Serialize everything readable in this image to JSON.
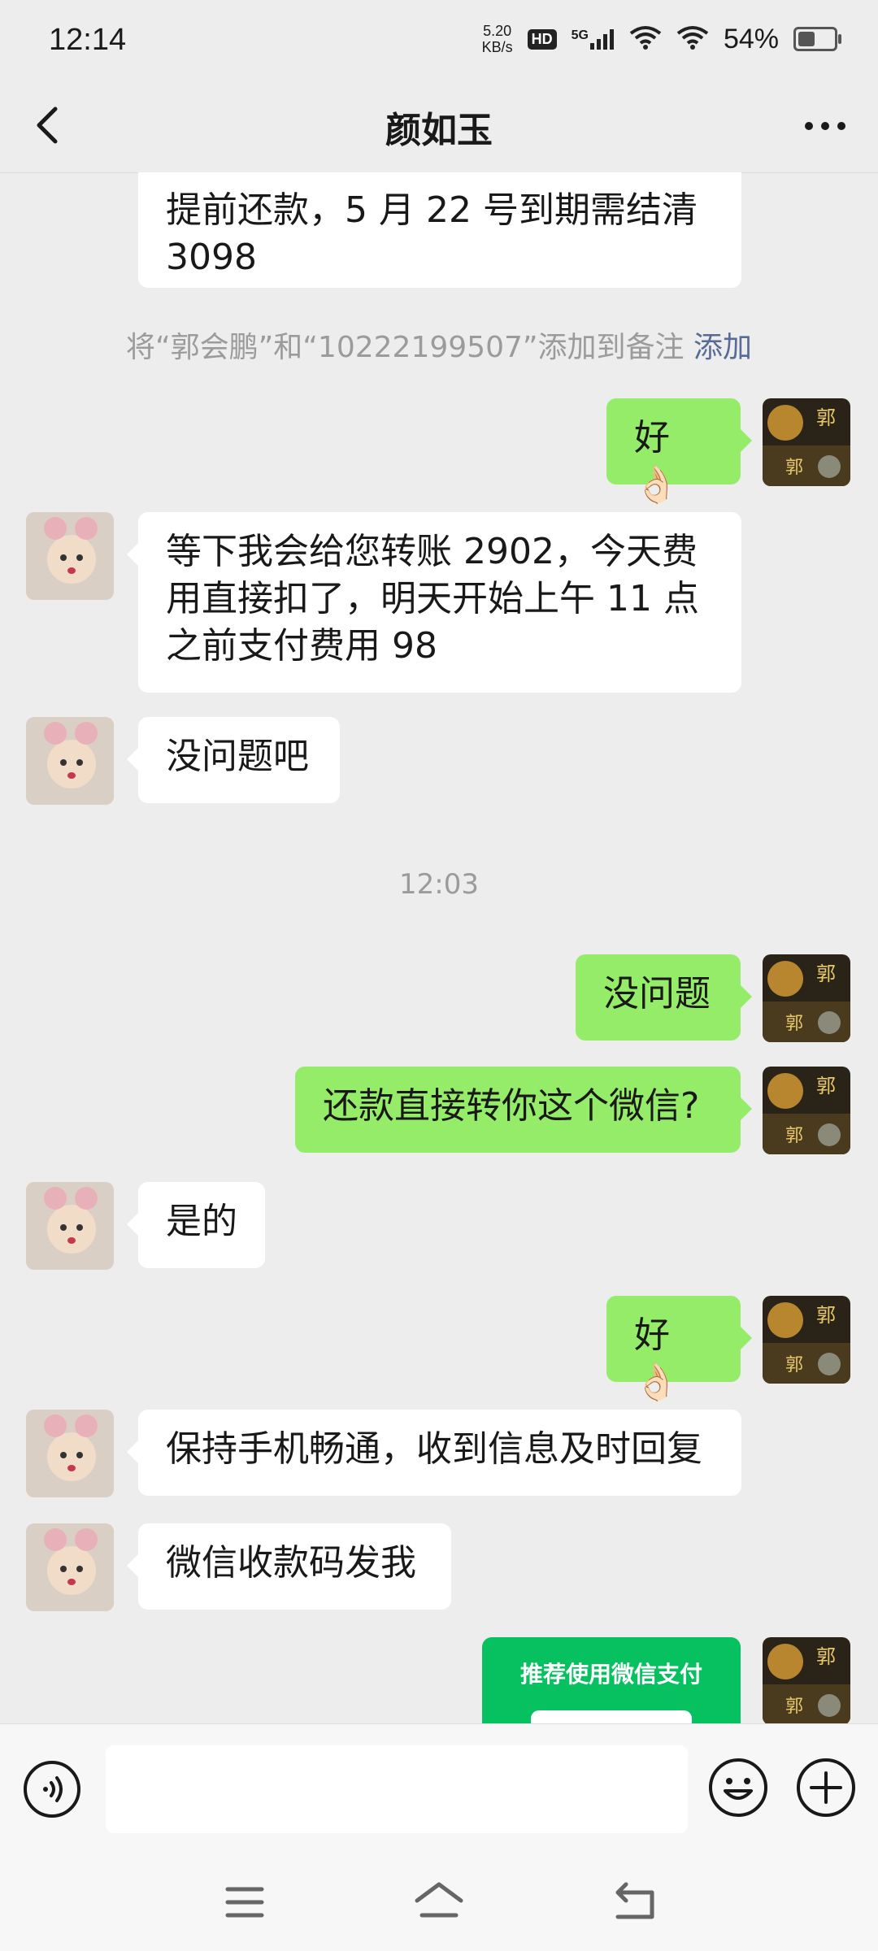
{
  "status_bar": {
    "time": "12:14",
    "net_speed_value": "5.20",
    "net_speed_unit": "KB/s",
    "hd_badge": "HD",
    "network_type": "5G",
    "battery": "54%"
  },
  "header": {
    "title": "颜如玉"
  },
  "messages": [
    {
      "side": "left",
      "text_line1": "提前还款，5 月 22 号到期需结清",
      "text_line2": "3098"
    },
    {
      "type": "notice",
      "text": "将“郭会鹏”和“10222199507”添加到备注",
      "link": "添加"
    },
    {
      "side": "right",
      "text": "好👌🏻"
    },
    {
      "side": "left",
      "text_line1": "等下我会给您转账 2902，今天费",
      "text_line2": "用直接扣了，明天开始上午 11 点",
      "text_line3": "之前支付费用 98"
    },
    {
      "side": "left",
      "text": "没问题吧"
    },
    {
      "type": "timestamp",
      "text": "12:03"
    },
    {
      "side": "right",
      "text": "没问题"
    },
    {
      "side": "right",
      "text": "还款直接转你这个微信?"
    },
    {
      "side": "left",
      "text": "是的"
    },
    {
      "side": "right",
      "text": "好👌🏻"
    },
    {
      "side": "left",
      "text": "保持手机畅通，收到信息及时回复"
    },
    {
      "side": "left",
      "text": "微信收款码发我"
    },
    {
      "side": "right",
      "type": "card",
      "text": "推荐使用微信支付"
    }
  ],
  "input_bar": {
    "placeholder": ""
  },
  "avatar_right_glyph": "郭",
  "colors": {
    "bubble_self": "#95ec69",
    "bubble_other": "#ffffff",
    "background": "#ededed",
    "link": "#576b95",
    "pay_card": "#07c160"
  },
  "icons": {
    "back": "chevron-left-icon",
    "more": "more-dots-icon",
    "voice": "voice-icon",
    "emoji": "emoji-icon",
    "plus": "plus-icon",
    "nav_menu": "menu-icon",
    "nav_home": "home-icon",
    "nav_back": "back-icon"
  }
}
